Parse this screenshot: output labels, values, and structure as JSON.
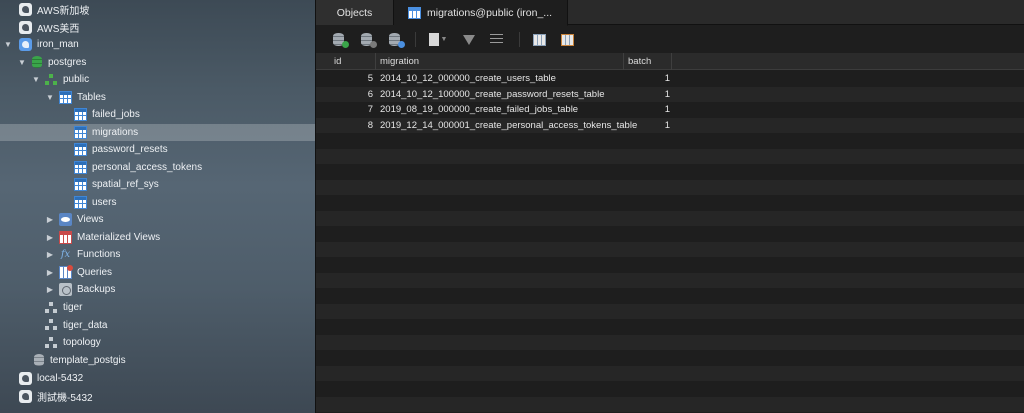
{
  "sidebar": {
    "items": [
      {
        "label": "AWS新加坡",
        "icon": "elephant-icon"
      },
      {
        "label": "AWS美西",
        "icon": "elephant-icon"
      },
      {
        "label": "iron_man",
        "icon": "elephant-icon"
      },
      {
        "label": "postgres",
        "icon": "database-icon"
      },
      {
        "label": "public",
        "icon": "schema-icon"
      },
      {
        "label": "Tables",
        "icon": "tables-icon"
      },
      {
        "label": "failed_jobs",
        "icon": "table-icon"
      },
      {
        "label": "migrations",
        "icon": "table-icon"
      },
      {
        "label": "password_resets",
        "icon": "table-icon"
      },
      {
        "label": "personal_access_tokens",
        "icon": "table-icon"
      },
      {
        "label": "spatial_ref_sys",
        "icon": "table-icon"
      },
      {
        "label": "users",
        "icon": "table-icon"
      },
      {
        "label": "Views",
        "icon": "views-icon"
      },
      {
        "label": "Materialized Views",
        "icon": "materialized-views-icon"
      },
      {
        "label": "Functions",
        "icon": "functions-icon"
      },
      {
        "label": "Queries",
        "icon": "queries-icon"
      },
      {
        "label": "Backups",
        "icon": "backups-icon"
      },
      {
        "label": "tiger",
        "icon": "schema-icon"
      },
      {
        "label": "tiger_data",
        "icon": "schema-icon"
      },
      {
        "label": "topology",
        "icon": "schema-icon"
      },
      {
        "label": "template_postgis",
        "icon": "database-icon"
      },
      {
        "label": "local-5432",
        "icon": "elephant-icon"
      },
      {
        "label": "測試機-5432",
        "icon": "elephant-icon"
      }
    ]
  },
  "tabs": {
    "objects": "Objects",
    "active": "migrations@public (iron_..."
  },
  "toolbar": {
    "icons": [
      "new-record-icon",
      "delete-record-icon",
      "refresh-icon",
      "text-view-icon",
      "filter-icon",
      "sort-icon",
      "import-icon",
      "export-icon"
    ]
  },
  "table": {
    "columns": [
      "id",
      "migration",
      "batch"
    ],
    "rows": [
      {
        "id": "5",
        "migration": "2014_10_12_000000_create_users_table",
        "batch": "1"
      },
      {
        "id": "6",
        "migration": "2014_10_12_100000_create_password_resets_table",
        "batch": "1"
      },
      {
        "id": "7",
        "migration": "2019_08_19_000000_create_failed_jobs_table",
        "batch": "1"
      },
      {
        "id": "8",
        "migration": "2019_12_14_000001_create_personal_access_tokens_table",
        "batch": "1"
      }
    ]
  },
  "colors": {
    "selected_row": "#6a7784",
    "accent_green": "#3aa54a",
    "accent_blue": "#4a8fe0"
  }
}
